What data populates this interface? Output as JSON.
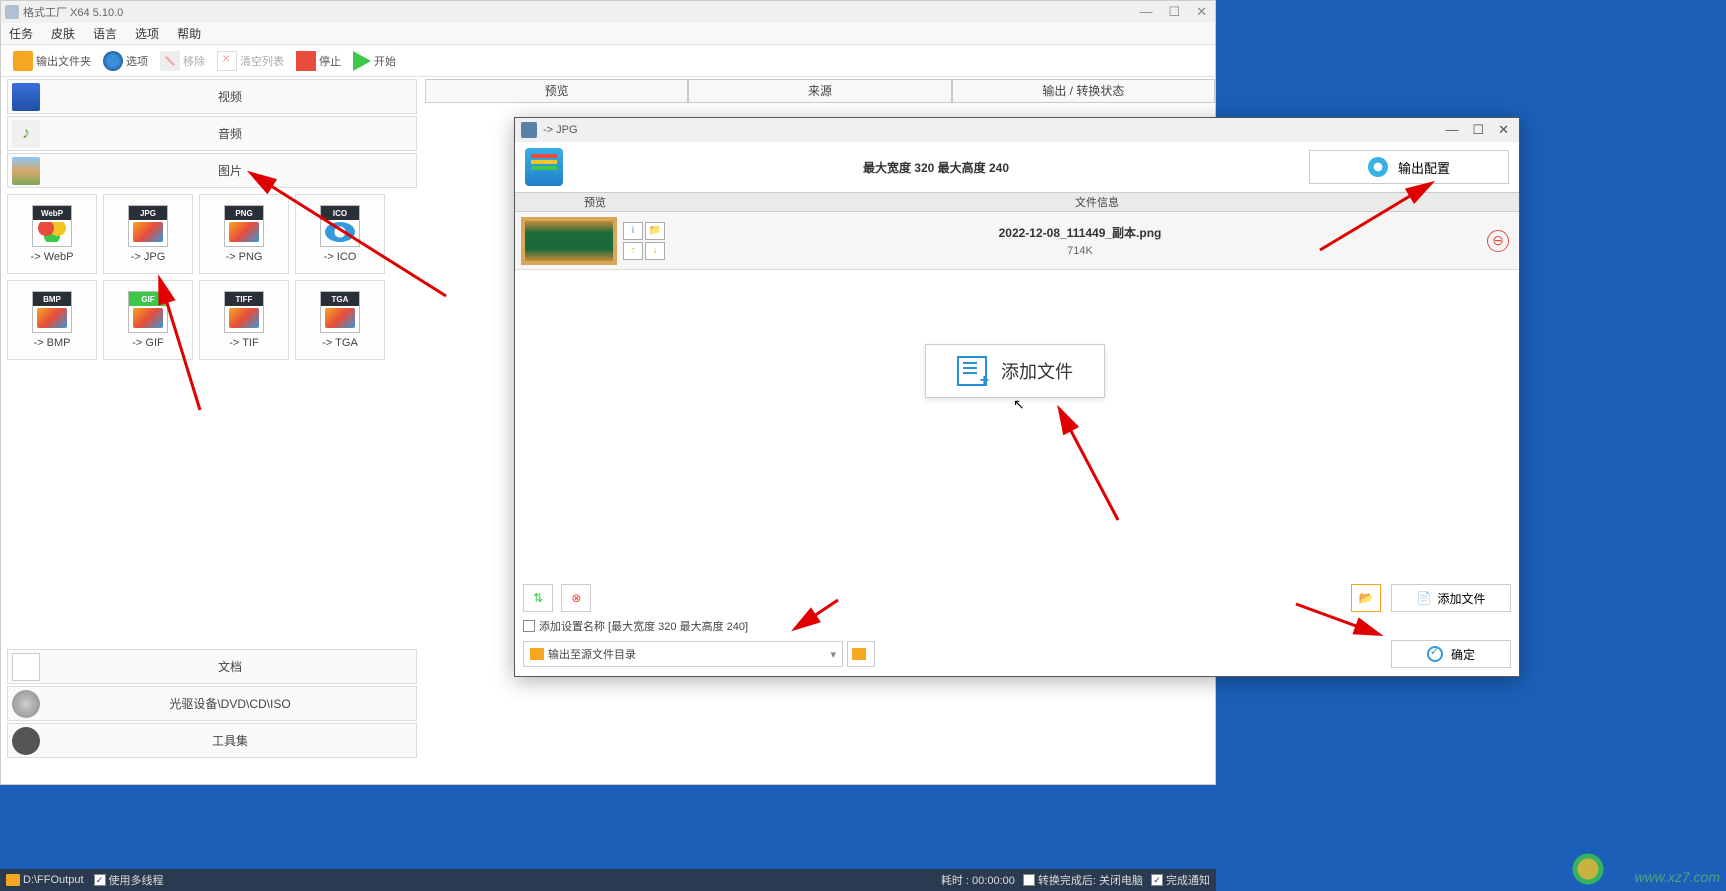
{
  "window": {
    "title": "格式工厂 X64 5.10.0",
    "minimize": "—",
    "maximize": "☐",
    "close": "✕"
  },
  "menu": [
    "任务",
    "皮肤",
    "语言",
    "选项",
    "帮助"
  ],
  "toolbar": {
    "output_folder": "输出文件夹",
    "options": "选项",
    "remove": "移除",
    "clear_list": "清空列表",
    "stop": "停止",
    "start": "开始"
  },
  "categories": {
    "video": "视频",
    "audio": "音频",
    "image": "图片",
    "document": "文档",
    "dvd": "光驱设备\\DVD\\CD\\ISO",
    "tools": "工具集"
  },
  "formats": [
    {
      "label": "-> WebP",
      "cls": "fi-webp"
    },
    {
      "label": "-> JPG",
      "cls": "fi-jpg"
    },
    {
      "label": "-> PNG",
      "cls": "fi-png"
    },
    {
      "label": "-> ICO",
      "cls": "fi-ico"
    },
    {
      "label": "-> BMP",
      "cls": "fi-bmp"
    },
    {
      "label": "-> GIF",
      "cls": "fi-gif"
    },
    {
      "label": "-> TIF",
      "cls": "fi-tiff"
    },
    {
      "label": "-> TGA",
      "cls": "fi-tga"
    }
  ],
  "tabs": {
    "preview": "预览",
    "source": "来源",
    "status": "输出 / 转换状态"
  },
  "statusbar": {
    "output_path": "D:\\FFOutput",
    "multithread": "使用多线程",
    "elapsed": "耗时 : 00:00:00",
    "after": "转换完成后: 关闭电脑",
    "notify": "完成通知"
  },
  "dialog": {
    "title": "-> JPG",
    "size_info": "最大宽度 320 最大高度 240",
    "output_config": "输出配置",
    "col_preview": "预览",
    "col_info": "文件信息",
    "file": {
      "name": "2022-12-08_111449_副本.png",
      "size": "714K"
    },
    "add_file_big": "添加文件",
    "add_setting_name": "添加设置名称 [最大宽度 320 最大高度 240]",
    "output_to_source": "输出至源文件目录",
    "add_file_btn": "添加文件",
    "ok": "确定",
    "minimize": "—",
    "maximize": "☐",
    "close": "✕"
  },
  "watermark": "www.xz7.com"
}
